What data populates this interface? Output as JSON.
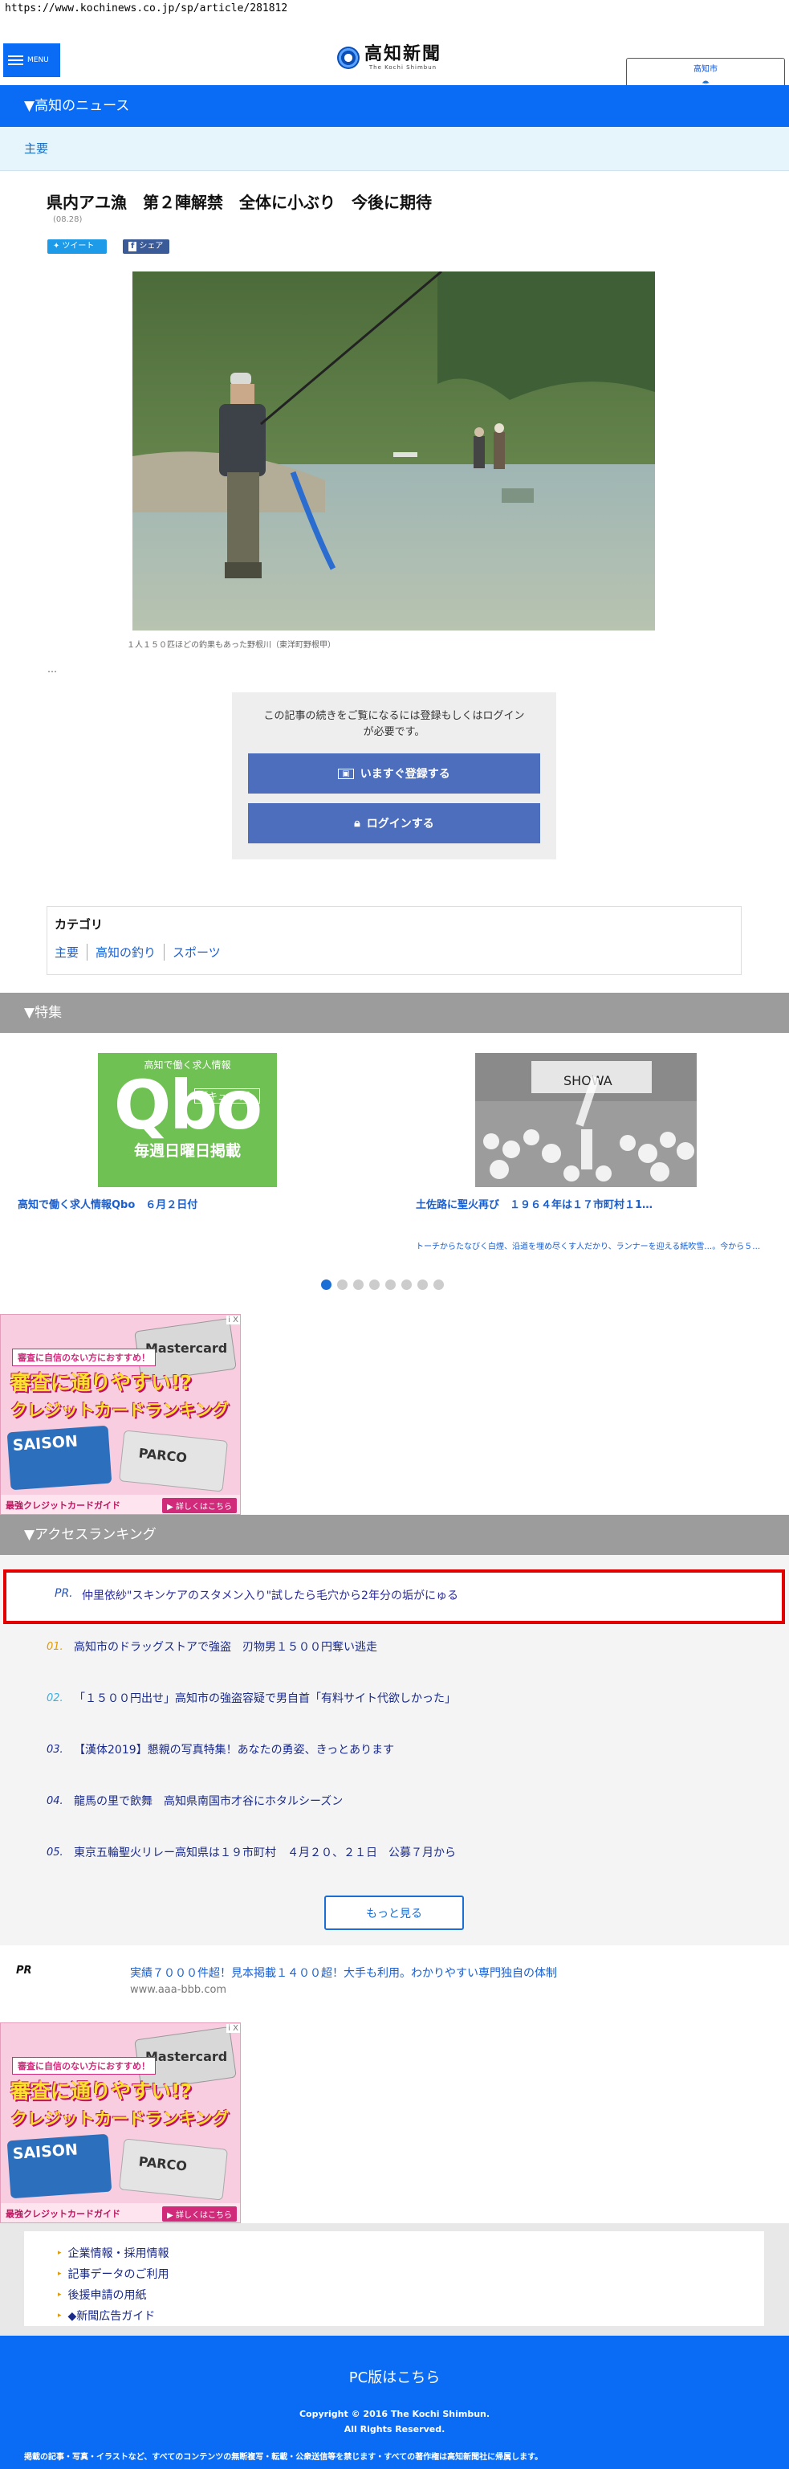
{
  "url": "https://www.kochinews.co.jp/sp/article/281812",
  "header": {
    "menu_label": "MENU",
    "logo_text": "高知新聞",
    "logo_sub": "The Kochi Shimbun",
    "weather_city": "高知市"
  },
  "section_news": "▼高知のニュース",
  "subsection": "主要",
  "article": {
    "title": "県内アユ漁　第２陣解禁　全体に小ぶり　今後に期待",
    "date": "(08.28)",
    "tweet_label": "ツイート",
    "share_label": "シェア",
    "caption": "１人１５０匹ほどの釣果もあった野根川（東洋町野根甲）",
    "ellipsis": "…"
  },
  "login": {
    "message_line1": "この記事の続きをご覧になるには登録もしくはログイン",
    "message_line2": "が必要です。",
    "register_label": "いますぐ登録する",
    "login_label": "ログインする"
  },
  "category": {
    "title": "カテゴリ",
    "links": [
      "主要",
      "高知の釣り",
      "スポーツ"
    ]
  },
  "section_features": "▼特集",
  "features": [
    {
      "title": "高知で働く求人情報Qbo　６月２日付",
      "desc": "",
      "banner_top": "高知で働く求人情報",
      "banner_logo": "Qbo",
      "banner_reading": "［キューボ］",
      "banner_bottom": "毎週日曜日掲載"
    },
    {
      "title": "土佐路に聖火再び　１９６４年は１７市町村１1…",
      "desc": "トーチからたなびく白煙、沿道を埋め尽くす人だかり、ランナーを迎える紙吹雪…。今から５…",
      "photo_sign": "SHOWA"
    }
  ],
  "carousel_dot_count": 8,
  "ad": {
    "label": "審査に自信のない方におすすめ！",
    "main_line1": "審査に通りやすい!?",
    "main_line2": "クレジットカードランキング",
    "card_brand": "Mastercard",
    "card_saison": "SAISON",
    "card_parco": "PARCO",
    "footer_left": "最強クレジットカードガイド",
    "footer_btn": "▶ 詳しくはこちら",
    "close_mark": "i X"
  },
  "section_ranking": "▼アクセスランキング",
  "ranking": {
    "pr_label": "PR.",
    "pr_title": "仲里依紗\"スキンケアのスタメン入り\"試したら毛穴から2年分の垢がにゅる",
    "items": [
      {
        "num": "01.",
        "title": "高知市のドラッグストアで強盗　刃物男１５００円奪い逃走"
      },
      {
        "num": "02.",
        "title": "「１５００円出せ」高知市の強盗容疑で男自首「有料サイト代欲しかった」"
      },
      {
        "num": "03.",
        "title": "【漢体2019】懇親の写真特集！あなたの勇姿、きっとあります"
      },
      {
        "num": "04.",
        "title": "龍馬の里で飲舞　高知県南国市才谷にホタルシーズン"
      },
      {
        "num": "05.",
        "title": "東京五輪聖火リレー高知県は１９市町村　４月２０、２１日　公募７月から"
      }
    ],
    "more_label": "もっと見る"
  },
  "pr2": {
    "label": "PR",
    "title": "実績７０００件超！見本掲載１４００超！大手も利用。わかりやすい専門独自の体制",
    "url": "www.aaa-bbb.com"
  },
  "footer_links": [
    "企業情報・採用情報",
    "記事データのご利用",
    "後援申請の用紙",
    "◆新聞広告ガイド"
  ],
  "footer": {
    "pc_link": "PC版はこちら",
    "copyright1": "Copyright © 2016 The Kochi Shimbun.",
    "copyright2": "All Rights Reserved.",
    "notice": "掲載の記事・写真・イラストなど、すべてのコンテンツの無断複写・転載・公衆送信等を禁じます・すべての著作権は高知新聞社に帰属します。"
  },
  "colors": {
    "brand_blue": "#0a6cf5",
    "section_gray": "#9c9c9c",
    "button_blue": "#4d6dbd",
    "highlight_red": "#e30000",
    "rank_orange": "#e39a00",
    "rank_lightblue": "#3ab0e0"
  },
  "icons": {
    "menu": "hamburger-icon",
    "weather": "weather-icon",
    "twitter": "twitter-icon",
    "facebook": "facebook-icon",
    "register": "id-card-icon",
    "login": "lock-icon"
  }
}
